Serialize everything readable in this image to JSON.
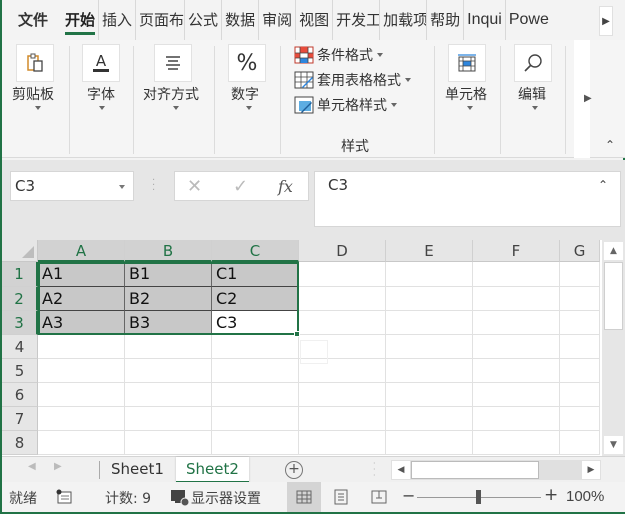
{
  "ribbon_tabs": [
    {
      "label": "文件",
      "kind": "file"
    },
    {
      "label": "开始",
      "active": true
    },
    {
      "label": "插入"
    },
    {
      "label": "页面布"
    },
    {
      "label": "公式"
    },
    {
      "label": "数据"
    },
    {
      "label": "审阅"
    },
    {
      "label": "视图"
    },
    {
      "label": "开发工"
    },
    {
      "label": "加载项"
    },
    {
      "label": "帮助"
    },
    {
      "label": "Inqui"
    },
    {
      "label": "Powe"
    }
  ],
  "ribbon": {
    "groups": {
      "clipboard": "剪贴板",
      "font": "字体",
      "alignment": "对齐方式",
      "number": "数字",
      "cells": "单元格",
      "editing": "编辑",
      "styles": "样式"
    },
    "styles_items": {
      "conditional": "条件格式",
      "table_format": "套用表格格式",
      "cell_styles": "单元格样式"
    },
    "icons": {
      "clipboard": "paste-icon",
      "font": "font-color-icon",
      "alignment": "align-center-icon",
      "number": "percent-icon",
      "cells": "cells-table-icon",
      "editing": "search-icon"
    }
  },
  "formula_bar": {
    "name_box": "C3",
    "cancel_glyph": "✕",
    "enter_glyph": "✓",
    "fx_label": "fx",
    "content": "C3"
  },
  "sheet": {
    "columns": [
      "A",
      "B",
      "C",
      "D",
      "E",
      "F",
      "G"
    ],
    "rows": [
      "1",
      "2",
      "3",
      "4",
      "5",
      "6",
      "7",
      "8"
    ],
    "cells": [
      [
        "A1",
        "B1",
        "C1"
      ],
      [
        "A2",
        "B2",
        "C2"
      ],
      [
        "A3",
        "B3",
        "C3"
      ]
    ],
    "selection": "A1:C3",
    "active_cell": "C3"
  },
  "sheet_tabs": [
    {
      "label": "Sheet1",
      "active": false
    },
    {
      "label": "Sheet2",
      "active": true
    }
  ],
  "add_sheet": "+",
  "status_bar": {
    "ready": "就绪",
    "count": "计数: 9",
    "display_settings": "显示器设置",
    "zoom": "100%",
    "zoom_percent": 100,
    "zoom_minus": "−",
    "zoom_plus": "+"
  },
  "colors": {
    "accent": "#217346",
    "selection_fill": "#c8c8c8"
  }
}
